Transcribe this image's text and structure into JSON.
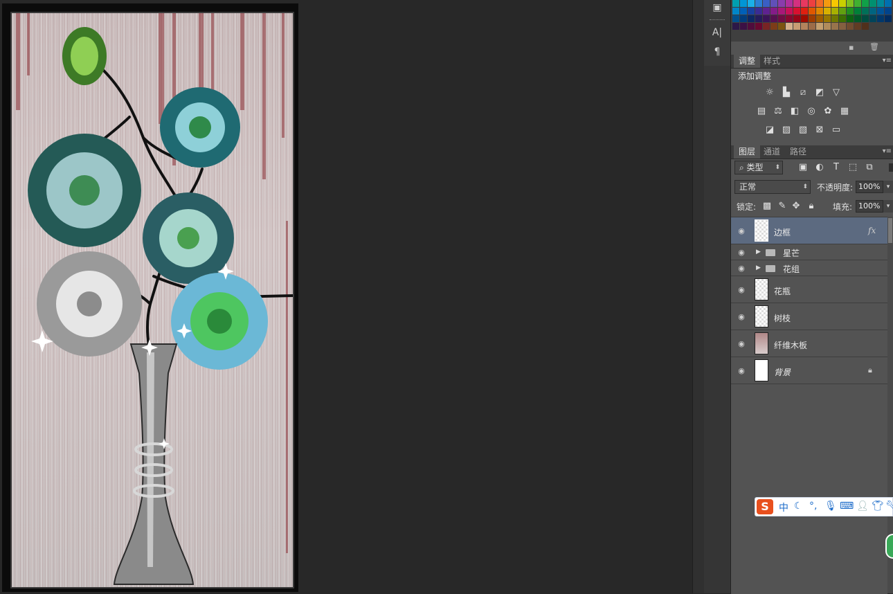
{
  "tool_dock": {
    "type_tool_label": "A|",
    "paragraph_label": "¶"
  },
  "swatches": {
    "rows": [
      [
        "#00a0b0",
        "#0096d6",
        "#1ab0e8",
        "#2a7fd4",
        "#3a5fc4",
        "#6050b8",
        "#8a3cac",
        "#b0309c",
        "#d43080",
        "#e83860",
        "#ee4040",
        "#f06a28",
        "#f49a10",
        "#f8c800",
        "#c8d000",
        "#80c020",
        "#40b030",
        "#10a048",
        "#009070",
        "#008898",
        "#0070b0"
      ],
      [
        "#0086c8",
        "#0060b8",
        "#1840a0",
        "#3a2c94",
        "#5e2290",
        "#841c88",
        "#a81878",
        "#c81058",
        "#d81030",
        "#e02010",
        "#e05800",
        "#e08800",
        "#d8b000",
        "#a8b000",
        "#60a010",
        "#209020",
        "#008038",
        "#007058",
        "#006480",
        "#005498",
        "#00448c"
      ],
      [
        "#00508c",
        "#003c7c",
        "#0c2864",
        "#241c5c",
        "#3a1458",
        "#561050",
        "#700c44",
        "#880830",
        "#980418",
        "#a00c00",
        "#a03c00",
        "#a05c00",
        "#987800",
        "#707800",
        "#3c7000",
        "#0c6410",
        "#005828",
        "#004c40",
        "#00445a",
        "#00386c",
        "#002c60"
      ],
      [
        "#2c1848",
        "#3c1044",
        "#500c3c",
        "#680830",
        "#782424",
        "#7c3c18",
        "#7c5410",
        "#d4b08c",
        "#c89c74",
        "#b4845c",
        "#9c6c48",
        "#c4a070",
        "#b08c5c",
        "#98744c",
        "#846040",
        "#704c30",
        "#603c24",
        "#50301c"
      ]
    ]
  },
  "adjustments_panel": {
    "tabs": [
      "调整",
      "样式"
    ],
    "title": "添加调整",
    "icons": [
      [
        "brightness-contrast-icon",
        "levels-icon",
        "curves-icon",
        "exposure-icon",
        "vibrance-icon"
      ],
      [
        "hue-saturation-icon",
        "color-balance-icon",
        "black-white-icon",
        "photo-filter-icon",
        "channel-mixer-icon",
        "color-lookup-icon"
      ],
      [
        "invert-icon",
        "posterize-icon",
        "threshold-icon",
        "selective-color-icon",
        "gradient-map-icon"
      ]
    ]
  },
  "layers_panel": {
    "tabs": [
      "图层",
      "通道",
      "路径"
    ],
    "filter_label": "类型",
    "blend_mode": "正常",
    "opacity_label": "不透明度:",
    "opacity_value": "100%",
    "lock_label": "锁定:",
    "fill_label": "填充:",
    "fill_value": "100%",
    "layers": [
      {
        "name": "边框",
        "type": "layer",
        "selected": true,
        "fx": "fx"
      },
      {
        "name": "星芒",
        "type": "group"
      },
      {
        "name": "花组",
        "type": "group"
      },
      {
        "name": "花瓶",
        "type": "layer"
      },
      {
        "name": "树枝",
        "type": "layer"
      },
      {
        "name": "纤维木板",
        "type": "layer"
      },
      {
        "name": "背景",
        "type": "background",
        "locked": true
      }
    ]
  },
  "ime_bar": {
    "logo": "S",
    "mode": "中"
  }
}
